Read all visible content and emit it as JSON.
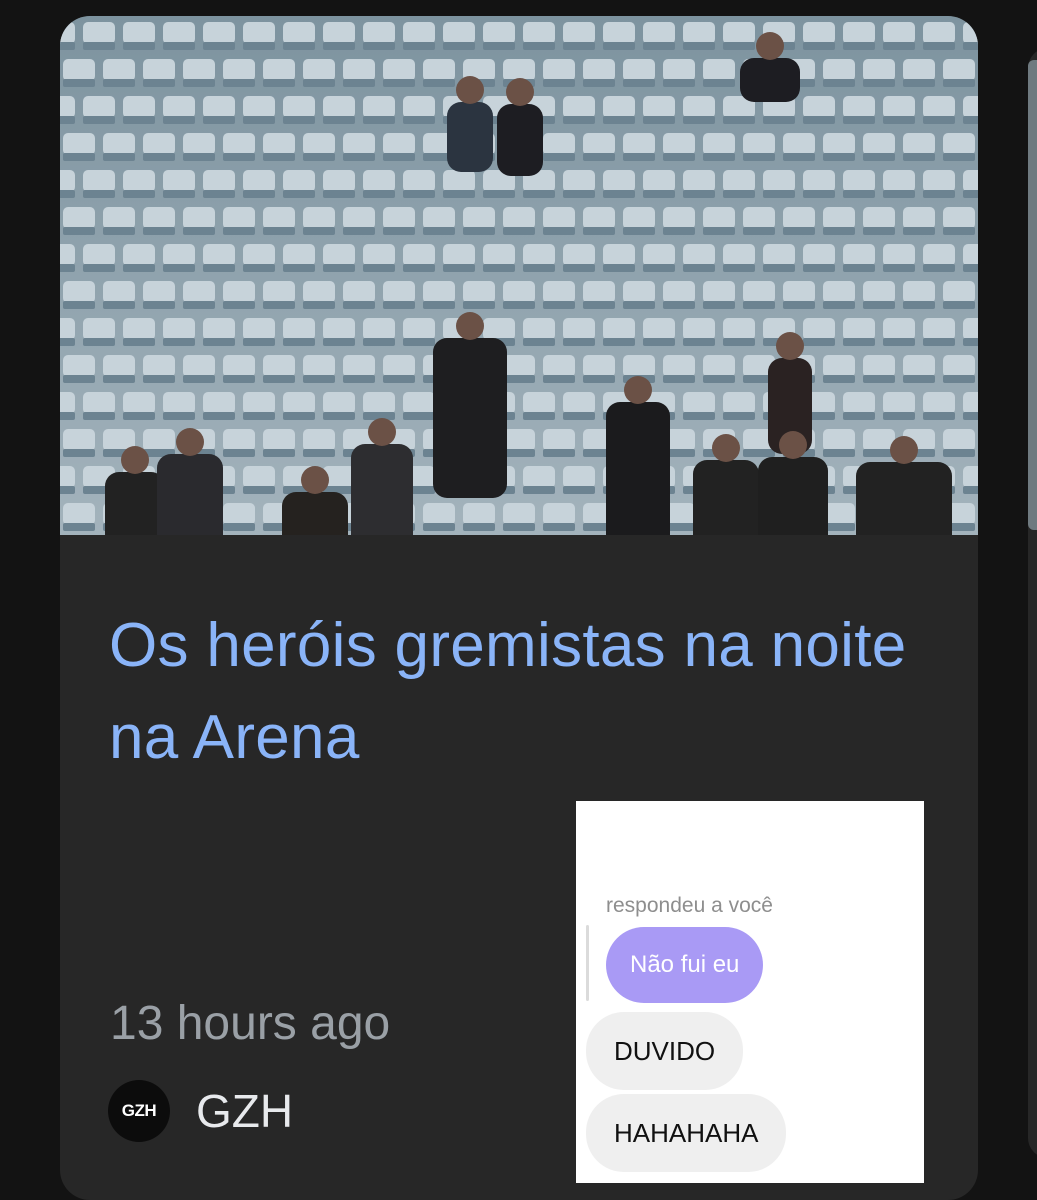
{
  "article": {
    "image_alt": "Torcedores em arquibancada vazia de estádio",
    "headline": "Os heróis gremistas na noite na Arena",
    "timestamp": "13 hours ago",
    "source": {
      "logo_text": "GZH",
      "name": "GZH"
    }
  },
  "overlay": {
    "reply_label": "respondeu a você",
    "quoted_message": "Não fui eu",
    "messages": [
      "DUVIDO",
      "HAHAHAHA"
    ]
  },
  "colors": {
    "background": "#131313",
    "card": "#272727",
    "headline": "#8ab4f8",
    "timestamp": "#9aa0a6",
    "quoted_bubble": "#a99af5",
    "message_bubble": "#efefef"
  }
}
